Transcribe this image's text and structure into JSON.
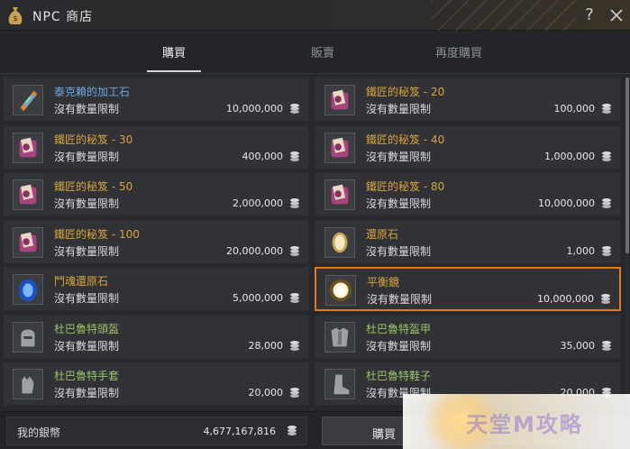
{
  "window": {
    "title": "NPC 商店",
    "help_label": "?",
    "accent_color": "#e07a1f"
  },
  "tabs": [
    {
      "label": "購買",
      "active": true
    },
    {
      "label": "販賣",
      "active": false
    },
    {
      "label": "再度購買",
      "active": false
    }
  ],
  "items": [
    {
      "name": "泰克賴的加工石",
      "limit": "沒有數量限制",
      "price": "10,000,000",
      "name_color": "blue",
      "icon": "crystal-icon"
    },
    {
      "name": "鐵匠的秘笈 - 20",
      "limit": "沒有數量限制",
      "price": "100,000",
      "name_color": "gold",
      "icon": "scroll-icon"
    },
    {
      "name": "鐵匠的秘笈 - 30",
      "limit": "沒有數量限制",
      "price": "400,000",
      "name_color": "gold",
      "icon": "scroll-icon"
    },
    {
      "name": "鐵匠的秘笈 - 40",
      "limit": "沒有數量限制",
      "price": "1,000,000",
      "name_color": "gold",
      "icon": "scroll-icon"
    },
    {
      "name": "鐵匠的秘笈 - 50",
      "limit": "沒有數量限制",
      "price": "2,000,000",
      "name_color": "gold",
      "icon": "scroll-icon"
    },
    {
      "name": "鐵匠的秘笈 - 80",
      "limit": "沒有數量限制",
      "price": "10,000,000",
      "name_color": "gold",
      "icon": "scroll-icon"
    },
    {
      "name": "鐵匠的秘笈 - 100",
      "limit": "沒有數量限制",
      "price": "20,000,000",
      "name_color": "gold",
      "icon": "scroll-icon"
    },
    {
      "name": "還原石",
      "limit": "沒有數量限制",
      "price": "1,000",
      "name_color": "gold",
      "icon": "restore-stone-icon"
    },
    {
      "name": "鬥魂還原石",
      "limit": "沒有數量限制",
      "price": "5,000,000",
      "name_color": "gold",
      "icon": "spirit-stone-icon"
    },
    {
      "name": "平衡鏡",
      "limit": "沒有數量限制",
      "price": "10,000,000",
      "name_color": "gold",
      "icon": "mirror-icon",
      "selected": true
    },
    {
      "name": "杜巴魯特頭盔",
      "limit": "沒有數量限制",
      "price": "28,000",
      "name_color": "green",
      "icon": "helmet-icon"
    },
    {
      "name": "杜巴魯特盔甲",
      "limit": "沒有數量限制",
      "price": "35,000",
      "name_color": "green",
      "icon": "armor-icon"
    },
    {
      "name": "杜巴魯特手套",
      "limit": "沒有數量限制",
      "price": "20,000",
      "name_color": "green",
      "icon": "gloves-icon"
    },
    {
      "name": "杜巴魯特鞋子",
      "limit": "沒有數量限制",
      "price": "20,000",
      "name_color": "green",
      "icon": "boots-icon"
    }
  ],
  "footer": {
    "wallet_label": "我的銀幣",
    "wallet_value": "4,677,167,816",
    "buy_label": "購買"
  },
  "watermark": {
    "text": "天堂M攻略"
  }
}
